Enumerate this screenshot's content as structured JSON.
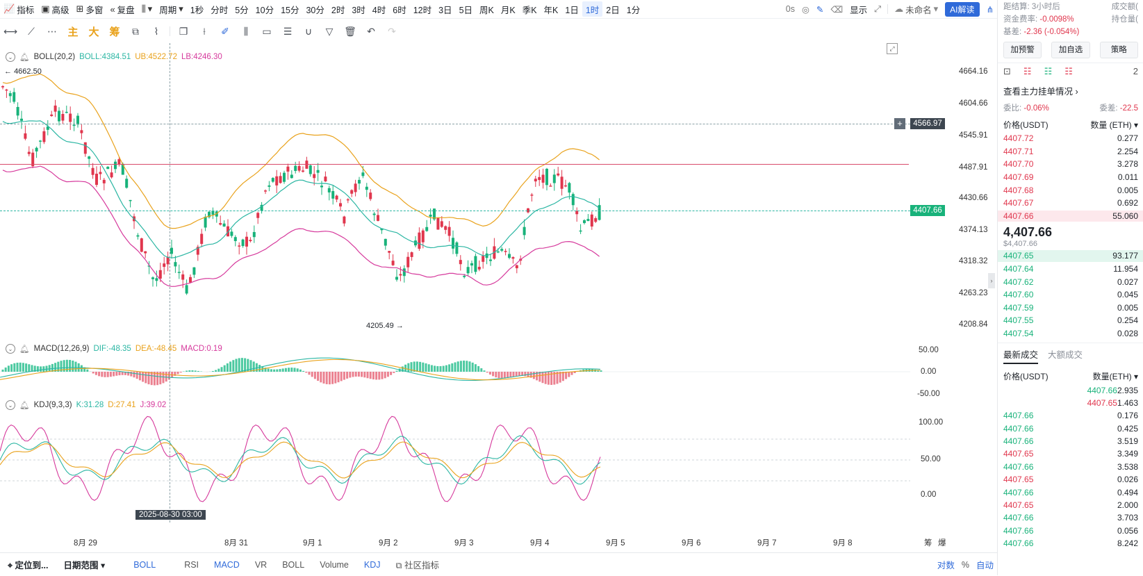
{
  "toolbar": {
    "items": [
      "指标",
      "高级",
      "多窗",
      "复盘",
      "周期",
      "1秒",
      "分时",
      "5分",
      "10分",
      "15分",
      "30分",
      "2时",
      "3时",
      "4时",
      "6时",
      "12时",
      "3日",
      "5日",
      "周K",
      "月K",
      "季K",
      "年K",
      "1日",
      "1时",
      "2日",
      "1分"
    ],
    "active_period": "1时",
    "right_items": [
      "0s",
      "显示",
      "未命名",
      "AI解读"
    ]
  },
  "drawbar": {
    "zh_items": [
      "主",
      "大",
      "筹"
    ]
  },
  "boll": {
    "name": "BOLL(20,2)",
    "boll": "BOLL:4384.51",
    "ub": "UB:4522.72",
    "lb": "LB:4246.30",
    "high_label": "4662.50",
    "low_label": "4205.49"
  },
  "macd": {
    "name": "MACD(12,26,9)",
    "dif": "DIF:-48.35",
    "dea": "DEA:-48.45",
    "macd": "MACD:0.19"
  },
  "kdj": {
    "name": "KDJ(9,3,3)",
    "k": "K:31.28",
    "d": "D:27.41",
    "j": "J:39.02"
  },
  "yaxis_price": [
    "4664.16",
    "4604.66",
    "4545.91",
    "4487.91",
    "4430.66",
    "4374.13",
    "4318.32",
    "4263.23",
    "4208.84"
  ],
  "price_tags": {
    "crosshair": "4566.97",
    "last": "4407.66"
  },
  "yaxis_macd": [
    "50.00",
    "0.00",
    "-50.00"
  ],
  "yaxis_kdj": [
    "100.00",
    "50.00",
    "0.00"
  ],
  "xaxis": [
    "8月 29",
    "8月 31",
    "9月 1",
    "9月 2",
    "9月 3",
    "9月 4",
    "9月 5",
    "9月 6",
    "9月 7",
    "9月 8"
  ],
  "crosshair_time": "2025-08-30 03:00",
  "xaxis_right": [
    "筹",
    "爆"
  ],
  "bottombar": {
    "locate": "定位到...",
    "range": "日期范围",
    "indicators": [
      "BOLL",
      "RSI",
      "MACD",
      "VR",
      "BOLL",
      "Volume",
      "KDJ"
    ],
    "community": "社区指标",
    "right": [
      "对数",
      "%",
      "自动"
    ]
  },
  "rightpanel": {
    "settle": "距结算:",
    "settle_val": "3小时后",
    "turnover": "成交额(",
    "funding": "资金费率:",
    "funding_val": "-0.0098%",
    "oi": "持仓量(",
    "basis": "基差:",
    "basis_val": "-2.36 (-0.054%)",
    "buttons": [
      "加预警",
      "加自选",
      "策略"
    ],
    "tab_extra": "2",
    "main_orders": "查看主力挂单情况",
    "ratio_label": "委比:",
    "ratio_val": "-0.06%",
    "diff_label": "委差:",
    "diff_val": "-22.5",
    "ob_header": [
      "价格(USDT)",
      "数量 (ETH)"
    ],
    "asks": [
      [
        "4407.72",
        "0.277"
      ],
      [
        "4407.71",
        "2.254"
      ],
      [
        "4407.70",
        "3.278"
      ],
      [
        "4407.69",
        "0.011"
      ],
      [
        "4407.68",
        "0.005"
      ],
      [
        "4407.67",
        "0.692"
      ],
      [
        "4407.66",
        "55.060"
      ]
    ],
    "last_price": "4,407.66",
    "last_usd": "$4,407.66",
    "bids": [
      [
        "4407.65",
        "93.177"
      ],
      [
        "4407.64",
        "11.954"
      ],
      [
        "4407.62",
        "0.027"
      ],
      [
        "4407.60",
        "0.045"
      ],
      [
        "4407.59",
        "0.005"
      ],
      [
        "4407.55",
        "0.254"
      ],
      [
        "4407.54",
        "0.028"
      ]
    ],
    "trade_tabs": [
      "最新成交",
      "大额成交"
    ],
    "trade_header": [
      "价格(USDT)",
      "数量(ETH)"
    ],
    "trades": [
      [
        "4407.66",
        "2.935",
        "g"
      ],
      [
        "4407.65",
        "1.463",
        "r"
      ],
      [
        "4407.66",
        "0.176",
        "g"
      ],
      [
        "4407.66",
        "0.425",
        "g"
      ],
      [
        "4407.66",
        "3.519",
        "g"
      ],
      [
        "4407.65",
        "3.349",
        "r"
      ],
      [
        "4407.66",
        "3.538",
        "g"
      ],
      [
        "4407.65",
        "0.026",
        "r"
      ],
      [
        "4407.66",
        "0.494",
        "g"
      ],
      [
        "4407.65",
        "2.000",
        "r"
      ],
      [
        "4407.66",
        "3.703",
        "g"
      ],
      [
        "4407.66",
        "0.056",
        "g"
      ],
      [
        "4407.66",
        "8.242",
        "g"
      ]
    ]
  }
}
